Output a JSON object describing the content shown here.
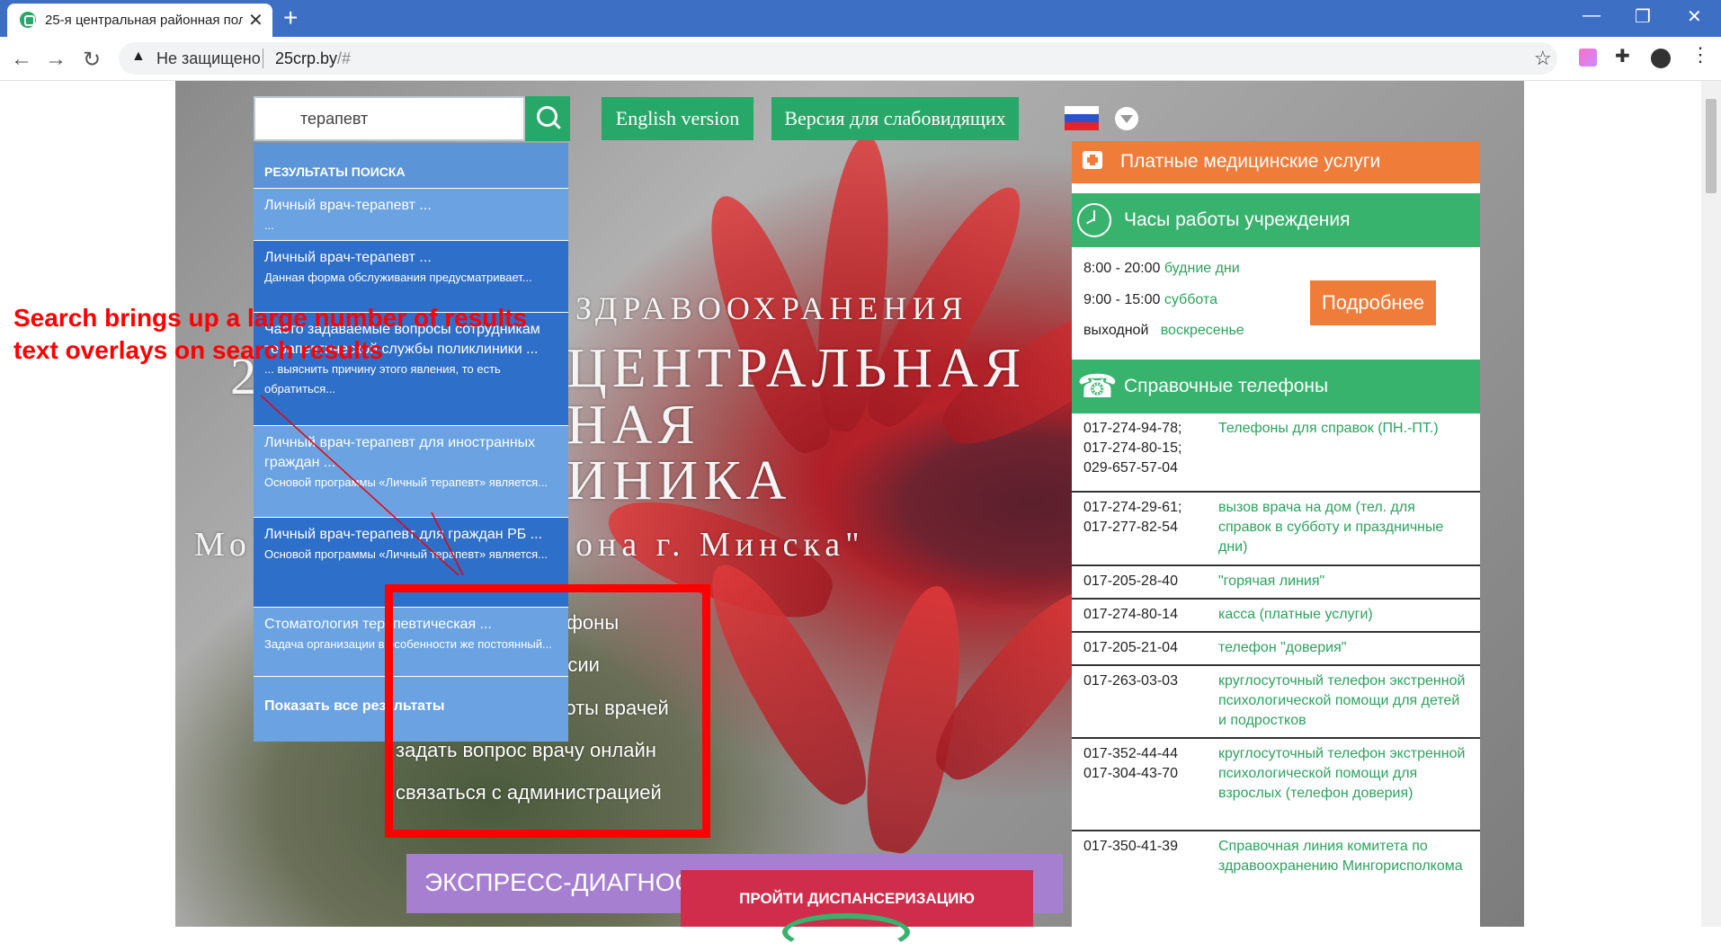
{
  "browser": {
    "tab_title": "25-я центральная районная пол",
    "tab_close": "✕",
    "new_tab": "+",
    "security_label": "Не защищено",
    "url_domain": "25crp.by",
    "url_path": "/#",
    "minimize": "—",
    "restore": "❐",
    "close": "✕"
  },
  "search": {
    "value": "терапевт",
    "results_header": "РЕЗУЛЬТАТЫ ПОИСКА",
    "results": [
      {
        "title": "Личный врач-терапевт ...",
        "desc": "..."
      },
      {
        "title": "Личный врач-терапевт ...",
        "desc": "Данная форма обслуживания предусматривает..."
      },
      {
        "title": "Часто задаваемые вопросы сотрудникам терапевтической службы поликлиники ...",
        "desc": "... выяснить причину этого явления, то есть обратиться..."
      },
      {
        "title": "Личный врач-терапевт для иностранных граждан ...",
        "desc": "Основой программы «Личный терапевт» является..."
      },
      {
        "title": "Личный врач-терапевт для граждан РБ ...",
        "desc": "Основой программы «Личный терапевт» является..."
      },
      {
        "title": "Стоматология терапевтическая ...",
        "desc": "Задача организации в особенности же постоянный..."
      }
    ],
    "show_all": "Показать все результаты"
  },
  "top_buttons": {
    "english": "English version",
    "low_vision": "Версия для слабовидящих"
  },
  "hero": {
    "line1": "ЗДРАВООХРАНЕНИЯ",
    "line2": "ЦЕНТРАЛЬНАЯ",
    "line3": "НАЯ",
    "line4": "ИНИКА",
    "digit": "2",
    "line5_left": "Мо",
    "line5_right": "она г. Минска\""
  },
  "quick_links": [
    "узнать все телефоны",
    "найти вакансии",
    "узнать график работы врачей",
    "задать вопрос врачу онлайн",
    "связаться с администрацией"
  ],
  "annotation": {
    "line1": "Search brings up a large number of results",
    "line2": "text overlays on search results"
  },
  "bottom": {
    "express": "ЭКСПРЕСС-ДИАГНОСТИКА ТУБЕРКУЛЕЗА",
    "dispensary": "ПРОЙТИ ДИСПАНСЕРИЗАЦИЮ"
  },
  "sidebar": {
    "paid_services": "Платные медицинские услуги",
    "hours_title": "Часы работы учреждения",
    "hours": [
      {
        "time": "8:00 - 20:00",
        "day": "будние дни"
      },
      {
        "time": "9:00 - 15:00",
        "day": "суббота"
      },
      {
        "time": "выходной",
        "day": "воскресенье"
      }
    ],
    "more_button": "Подробнее",
    "phones_title": "Справочные телефоны",
    "phones": [
      {
        "num": "017-274-94-78;\n017-274-80-15;\n029-657-57-04",
        "desc": "Телефоны для справок (ПН.-ПТ.)"
      },
      {
        "num": "017-274-29-61;\n017-277-82-54",
        "desc": "вызов врача на дом (тел. для справок в субботу и праздничные дни)"
      },
      {
        "num": "017-205-28-40",
        "desc": "\"горячая линия\""
      },
      {
        "num": "017-274-80-14",
        "desc": "касса (платные услуги)"
      },
      {
        "num": "017-205-21-04",
        "desc": "телефон \"доверия\""
      },
      {
        "num": "017-263-03-03",
        "desc": "круглосуточный телефон экстренной психологической помощи для детей и подростков"
      },
      {
        "num": "017-352-44-44\n017-304-43-70",
        "desc": "круглосуточный телефон экстренной психологической помощи для взрослых (телефон доверия)"
      },
      {
        "num": "017-350-41-39",
        "desc": "Справочная линия комитета по здравоохранению Мингорисполкома"
      }
    ]
  },
  "colors": {
    "brand_green": "#27a869",
    "orange": "#f07c3a",
    "search_blue": "#2e6fc9",
    "annotation_red": "#ff0000"
  }
}
